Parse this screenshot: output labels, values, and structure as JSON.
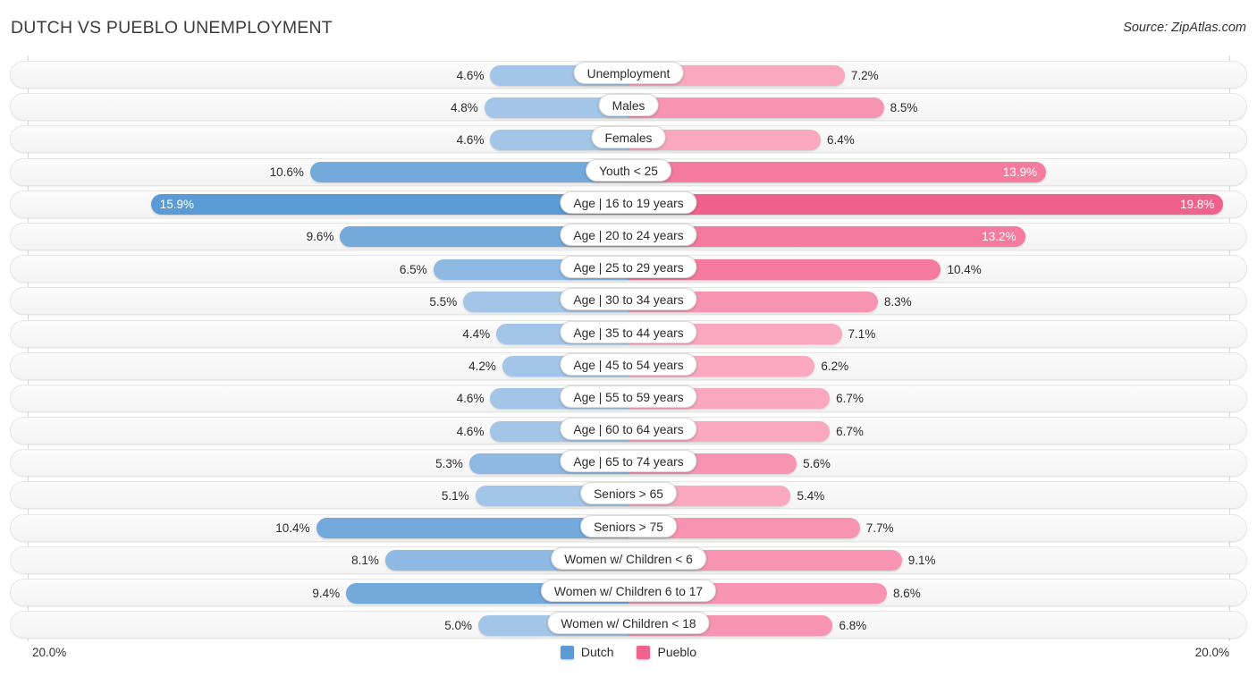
{
  "header": {
    "title": "DUTCH VS PUEBLO UNEMPLOYMENT",
    "source": "Source: ZipAtlas.com"
  },
  "axis": {
    "left_label": "20.0%",
    "right_label": "20.0%",
    "max": 20.0
  },
  "legend": {
    "items": [
      {
        "label": "Dutch",
        "color": "#5b9bd5"
      },
      {
        "label": "Pueblo",
        "color": "#f0638f"
      }
    ]
  },
  "colors": {
    "dutch_light": "#a3c6e8",
    "dutch_mid": "#8db9e2",
    "dutch_strong": "#74a9dc",
    "dutch_dark": "#5b9bd5",
    "pueblo_light": "#f9a8c0",
    "pueblo_mid": "#f794b3",
    "pueblo_strong": "#f47a9e",
    "pueblo_dark": "#f0628e",
    "track": "#f6f6f6",
    "gridline": "#d8d8d8"
  },
  "chart_data": {
    "type": "bar",
    "orientation": "diverging-horizontal",
    "title": "DUTCH VS PUEBLO UNEMPLOYMENT",
    "xlabel": "",
    "ylabel": "",
    "xlim": [
      20.0,
      20.0
    ],
    "grid": true,
    "legend_position": "bottom-center",
    "categories": [
      "Unemployment",
      "Males",
      "Females",
      "Youth < 25",
      "Age | 16 to 19 years",
      "Age | 20 to 24 years",
      "Age | 25 to 29 years",
      "Age | 30 to 34 years",
      "Age | 35 to 44 years",
      "Age | 45 to 54 years",
      "Age | 55 to 59 years",
      "Age | 60 to 64 years",
      "Age | 65 to 74 years",
      "Seniors > 65",
      "Seniors > 75",
      "Women w/ Children < 6",
      "Women w/ Children 6 to 17",
      "Women w/ Children < 18"
    ],
    "series": [
      {
        "name": "Dutch",
        "color": "#5b9bd5",
        "values": [
          4.6,
          4.8,
          4.6,
          10.6,
          15.9,
          9.6,
          6.5,
          5.5,
          4.4,
          4.2,
          4.6,
          4.6,
          5.3,
          5.1,
          10.4,
          8.1,
          9.4,
          5.0
        ],
        "labels": [
          "4.6%",
          "4.8%",
          "4.6%",
          "10.6%",
          "15.9%",
          "9.6%",
          "6.5%",
          "5.5%",
          "4.4%",
          "4.2%",
          "4.6%",
          "4.6%",
          "5.3%",
          "5.1%",
          "10.4%",
          "8.1%",
          "9.4%",
          "5.0%"
        ]
      },
      {
        "name": "Pueblo",
        "color": "#f0628e",
        "values": [
          7.2,
          8.5,
          6.4,
          13.9,
          19.8,
          13.2,
          10.4,
          8.3,
          7.1,
          6.2,
          6.7,
          6.7,
          5.6,
          5.4,
          7.7,
          9.1,
          8.6,
          6.8
        ],
        "labels": [
          "7.2%",
          "8.5%",
          "6.4%",
          "13.9%",
          "19.8%",
          "13.2%",
          "10.4%",
          "8.3%",
          "7.1%",
          "6.2%",
          "6.7%",
          "6.7%",
          "5.6%",
          "5.4%",
          "7.7%",
          "9.1%",
          "8.6%",
          "6.8%"
        ]
      }
    ]
  },
  "rows": [
    {
      "label": "Unemployment",
      "left": {
        "value": 4.6,
        "text": "4.6%",
        "inside": false,
        "shade": "light"
      },
      "right": {
        "value": 7.2,
        "text": "7.2%",
        "inside": false,
        "shade": "light"
      }
    },
    {
      "label": "Males",
      "left": {
        "value": 4.8,
        "text": "4.8%",
        "inside": false,
        "shade": "light"
      },
      "right": {
        "value": 8.5,
        "text": "8.5%",
        "inside": false,
        "shade": "mid"
      }
    },
    {
      "label": "Females",
      "left": {
        "value": 4.6,
        "text": "4.6%",
        "inside": false,
        "shade": "light"
      },
      "right": {
        "value": 6.4,
        "text": "6.4%",
        "inside": false,
        "shade": "light"
      }
    },
    {
      "label": "Youth < 25",
      "left": {
        "value": 10.6,
        "text": "10.6%",
        "inside": false,
        "shade": "strong"
      },
      "right": {
        "value": 13.9,
        "text": "13.9%",
        "inside": true,
        "shade": "strong"
      }
    },
    {
      "label": "Age | 16 to 19 years",
      "left": {
        "value": 15.9,
        "text": "15.9%",
        "inside": true,
        "shade": "dark"
      },
      "right": {
        "value": 19.8,
        "text": "19.8%",
        "inside": true,
        "shade": "dark"
      }
    },
    {
      "label": "Age | 20 to 24 years",
      "left": {
        "value": 9.6,
        "text": "9.6%",
        "inside": false,
        "shade": "strong"
      },
      "right": {
        "value": 13.2,
        "text": "13.2%",
        "inside": true,
        "shade": "strong"
      }
    },
    {
      "label": "Age | 25 to 29 years",
      "left": {
        "value": 6.5,
        "text": "6.5%",
        "inside": false,
        "shade": "mid"
      },
      "right": {
        "value": 10.4,
        "text": "10.4%",
        "inside": false,
        "shade": "strong"
      }
    },
    {
      "label": "Age | 30 to 34 years",
      "left": {
        "value": 5.5,
        "text": "5.5%",
        "inside": false,
        "shade": "light"
      },
      "right": {
        "value": 8.3,
        "text": "8.3%",
        "inside": false,
        "shade": "mid"
      }
    },
    {
      "label": "Age | 35 to 44 years",
      "left": {
        "value": 4.4,
        "text": "4.4%",
        "inside": false,
        "shade": "light"
      },
      "right": {
        "value": 7.1,
        "text": "7.1%",
        "inside": false,
        "shade": "light"
      }
    },
    {
      "label": "Age | 45 to 54 years",
      "left": {
        "value": 4.2,
        "text": "4.2%",
        "inside": false,
        "shade": "light"
      },
      "right": {
        "value": 6.2,
        "text": "6.2%",
        "inside": false,
        "shade": "light"
      }
    },
    {
      "label": "Age | 55 to 59 years",
      "left": {
        "value": 4.6,
        "text": "4.6%",
        "inside": false,
        "shade": "light"
      },
      "right": {
        "value": 6.7,
        "text": "6.7%",
        "inside": false,
        "shade": "light"
      }
    },
    {
      "label": "Age | 60 to 64 years",
      "left": {
        "value": 4.6,
        "text": "4.6%",
        "inside": false,
        "shade": "light"
      },
      "right": {
        "value": 6.7,
        "text": "6.7%",
        "inside": false,
        "shade": "light"
      }
    },
    {
      "label": "Age | 65 to 74 years",
      "left": {
        "value": 5.3,
        "text": "5.3%",
        "inside": false,
        "shade": "mid"
      },
      "right": {
        "value": 5.6,
        "text": "5.6%",
        "inside": false,
        "shade": "mid"
      }
    },
    {
      "label": "Seniors > 65",
      "left": {
        "value": 5.1,
        "text": "5.1%",
        "inside": false,
        "shade": "light"
      },
      "right": {
        "value": 5.4,
        "text": "5.4%",
        "inside": false,
        "shade": "light"
      }
    },
    {
      "label": "Seniors > 75",
      "left": {
        "value": 10.4,
        "text": "10.4%",
        "inside": false,
        "shade": "strong"
      },
      "right": {
        "value": 7.7,
        "text": "7.7%",
        "inside": false,
        "shade": "mid"
      }
    },
    {
      "label": "Women w/ Children < 6",
      "left": {
        "value": 8.1,
        "text": "8.1%",
        "inside": false,
        "shade": "mid"
      },
      "right": {
        "value": 9.1,
        "text": "9.1%",
        "inside": false,
        "shade": "mid"
      }
    },
    {
      "label": "Women w/ Children 6 to 17",
      "left": {
        "value": 9.4,
        "text": "9.4%",
        "inside": false,
        "shade": "strong"
      },
      "right": {
        "value": 8.6,
        "text": "8.6%",
        "inside": false,
        "shade": "mid"
      }
    },
    {
      "label": "Women w/ Children < 18",
      "left": {
        "value": 5.0,
        "text": "5.0%",
        "inside": false,
        "shade": "light"
      },
      "right": {
        "value": 6.8,
        "text": "6.8%",
        "inside": false,
        "shade": "mid"
      }
    }
  ]
}
